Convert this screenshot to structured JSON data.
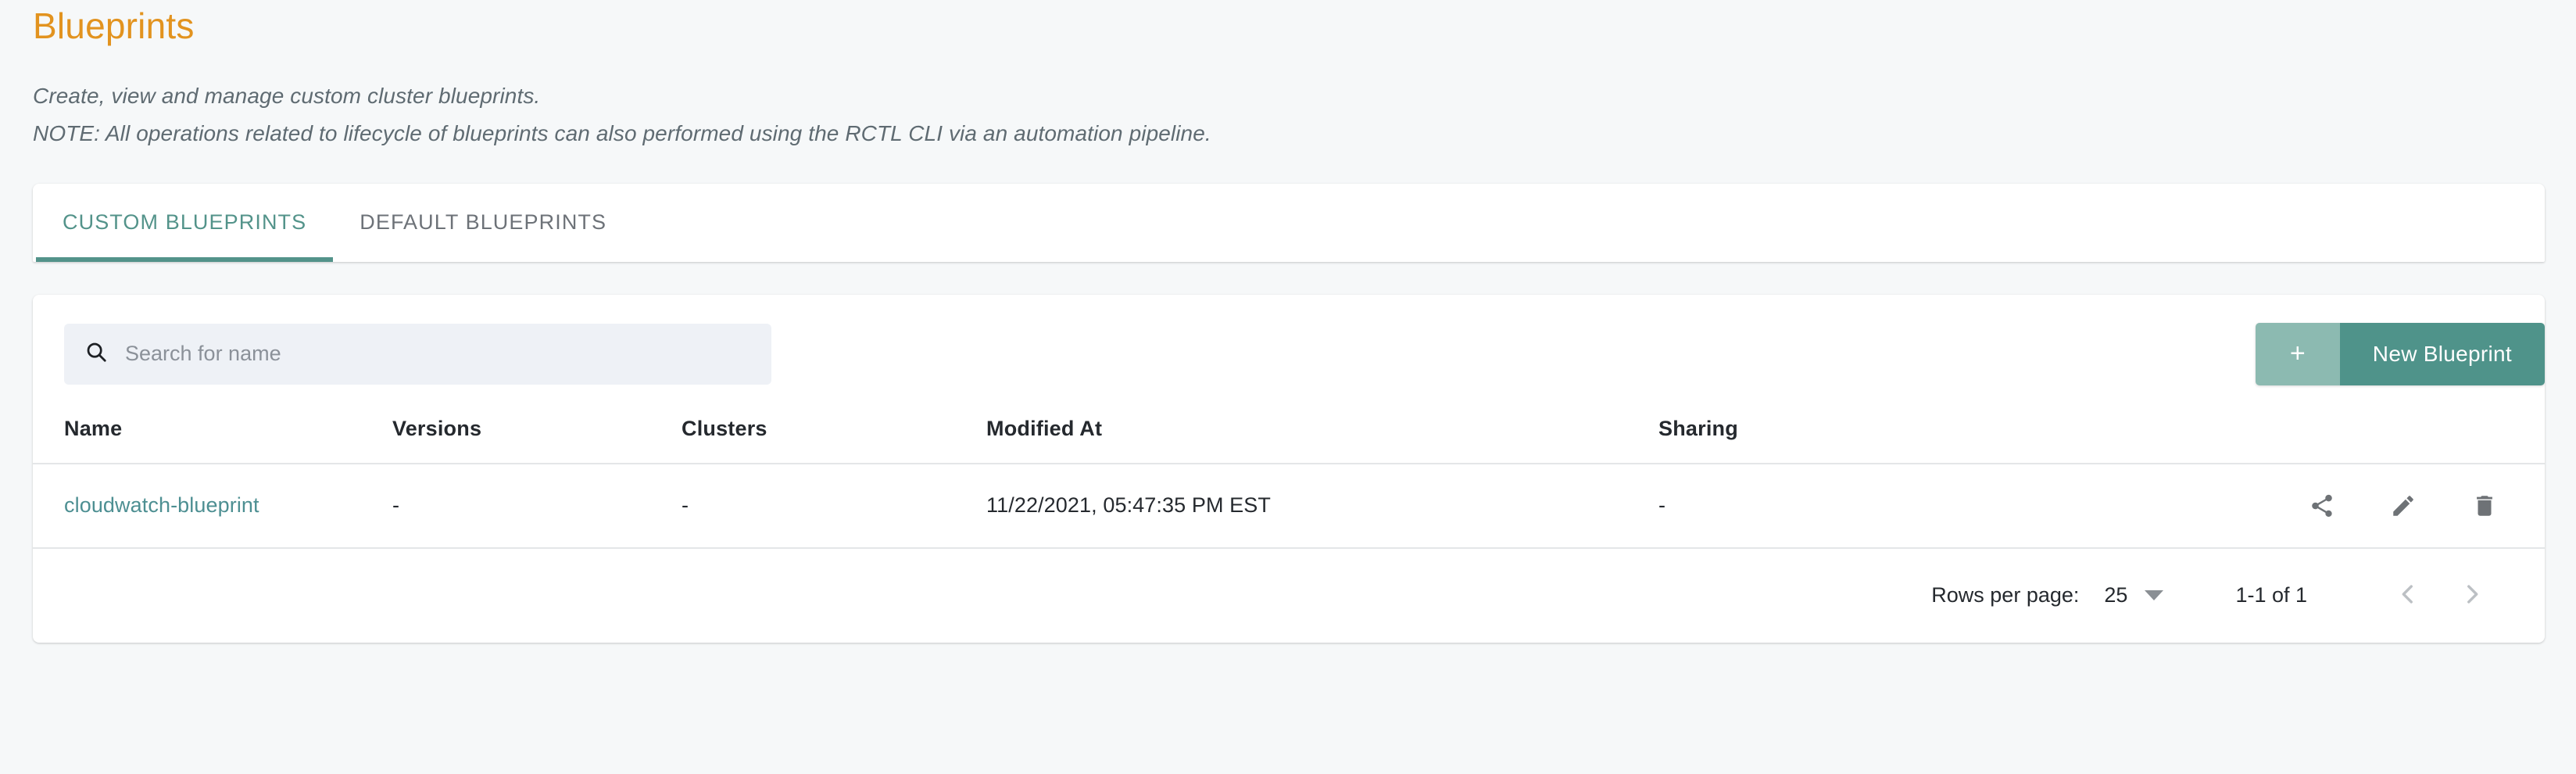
{
  "header": {
    "title": "Blueprints",
    "subtitle_lines": [
      "Create, view and manage custom cluster blueprints.",
      "NOTE: All operations related to lifecycle of blueprints can also performed using the RCTL CLI via an automation pipeline."
    ]
  },
  "tabs": [
    {
      "label": "CUSTOM BLUEPRINTS",
      "active": true
    },
    {
      "label": "DEFAULT BLUEPRINTS",
      "active": false
    }
  ],
  "toolbar": {
    "search_placeholder": "Search for name",
    "search_value": "",
    "new_button_plus": "+",
    "new_button_label": "New Blueprint"
  },
  "table": {
    "columns": [
      "Name",
      "Versions",
      "Clusters",
      "Modified At",
      "Sharing"
    ],
    "rows": [
      {
        "name": "cloudwatch-blueprint",
        "versions": "-",
        "clusters": "-",
        "modified_at": "11/22/2021, 05:47:35 PM EST",
        "sharing": "-"
      }
    ]
  },
  "footer": {
    "rows_per_page_label": "Rows per page:",
    "rows_per_page_value": "25",
    "range_label": "1-1 of 1"
  },
  "colors": {
    "title_orange": "#e2931f",
    "accent_teal": "#53938a",
    "button_teal": "#4f938a",
    "button_teal_light": "#8cbab1",
    "link_teal": "#4d8f92",
    "page_background": "#f6f8f9",
    "search_background": "#eef1f6"
  }
}
